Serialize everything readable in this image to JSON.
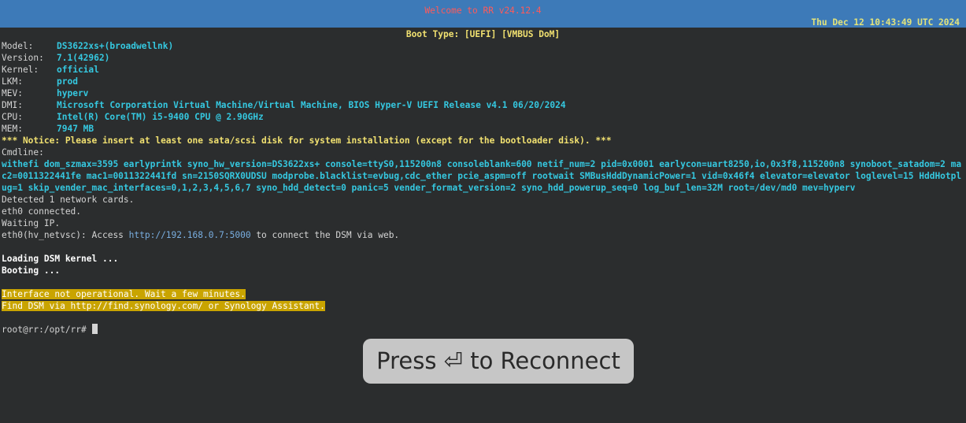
{
  "header": {
    "title": "Welcome to RR v24.12.4",
    "datetime": "Thu Dec 12 10:43:49 UTC 2024",
    "boot_type": "Boot Type: [UEFI] [VMBUS DoM]"
  },
  "system_info": [
    {
      "key": "Model:",
      "value": "DS3622xs+(broadwellnk)"
    },
    {
      "key": "Version:",
      "value": "7.1(42962)"
    },
    {
      "key": "Kernel:",
      "value": "official"
    },
    {
      "key": "LKM:",
      "value": "prod"
    },
    {
      "key": "MEV:",
      "value": "hyperv"
    },
    {
      "key": "DMI:",
      "value": "Microsoft Corporation Virtual Machine/Virtual Machine, BIOS Hyper-V UEFI Release v4.1 06/20/2024"
    },
    {
      "key": "CPU:",
      "value": "Intel(R) Core(TM) i5-9400 CPU @ 2.90GHz"
    },
    {
      "key": "MEM:",
      "value": "7947 MB"
    }
  ],
  "notice": "*** Notice: Please insert at least one sata/scsi disk for system installation (except for the bootloader disk). ***",
  "cmdline_label": "Cmdline:",
  "cmdline": "withefi dom_szmax=3595 earlyprintk syno_hw_version=DS3622xs+ console=ttyS0,115200n8 consoleblank=600 netif_num=2 pid=0x0001 earlycon=uart8250,io,0x3f8,115200n8 synoboot_satadom=2 mac2=0011322441fe mac1=0011322441fd sn=2150SQRX0UDSU modprobe.blacklist=evbug,cdc_ether pcie_aspm=off rootwait SMBusHddDynamicPower=1 vid=0x46f4 elevator=elevator loglevel=15 HddHotplug=1 skip_vender_mac_interfaces=0,1,2,3,4,5,6,7 syno_hdd_detect=0 panic=5 vender_format_version=2 syno_hdd_powerup_seq=0 log_buf_len=32M root=/dev/md0 mev=hyperv",
  "network": {
    "detected": "Detected 1 network cards.",
    "connected": "eth0 connected.",
    "waiting": "Waiting IP.",
    "access_prefix": "eth0(hv_netvsc): Access ",
    "access_url": "http://192.168.0.7:5000",
    "access_suffix": " to connect the DSM via web."
  },
  "loading": "Loading DSM kernel ...",
  "booting": "Booting ...",
  "warning_line1": "Interface not operational. Wait a few minutes.",
  "warning_line2": "Find DSM via http://find.synology.com/ or Synology Assistant.",
  "prompt": "root@rr:/opt/rr# ",
  "reconnect_label": "Press ⏎ to Reconnect",
  "colors": {
    "banner_bg": "#3d7ab8",
    "title": "#ff5a5a",
    "value": "#35c8e0",
    "notice": "#f0e070",
    "highlight": "#c9a400"
  }
}
